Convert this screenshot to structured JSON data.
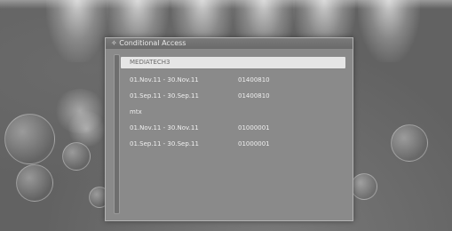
{
  "dialog": {
    "title": "✧ Conditional Access"
  },
  "list": {
    "items": [
      {
        "type": "header",
        "label": "MEDIATECH3",
        "selected": true
      },
      {
        "type": "entry",
        "dates": "01.Nov.11 - 30.Nov.11",
        "id": "01400810"
      },
      {
        "type": "entry",
        "dates": "01.Sep.11 - 30.Sep.11",
        "id": "01400810"
      },
      {
        "type": "header",
        "label": "mtx"
      },
      {
        "type": "entry",
        "dates": "01.Nov.11 - 30.Nov.11",
        "id": "01000001"
      },
      {
        "type": "entry",
        "dates": "01.Sep.11 - 30.Sep.11",
        "id": "01000001"
      }
    ]
  },
  "colors": {
    "dialog_bg": "#8a8a8a",
    "selection": "#e6e6e6",
    "text": "#efefef"
  }
}
